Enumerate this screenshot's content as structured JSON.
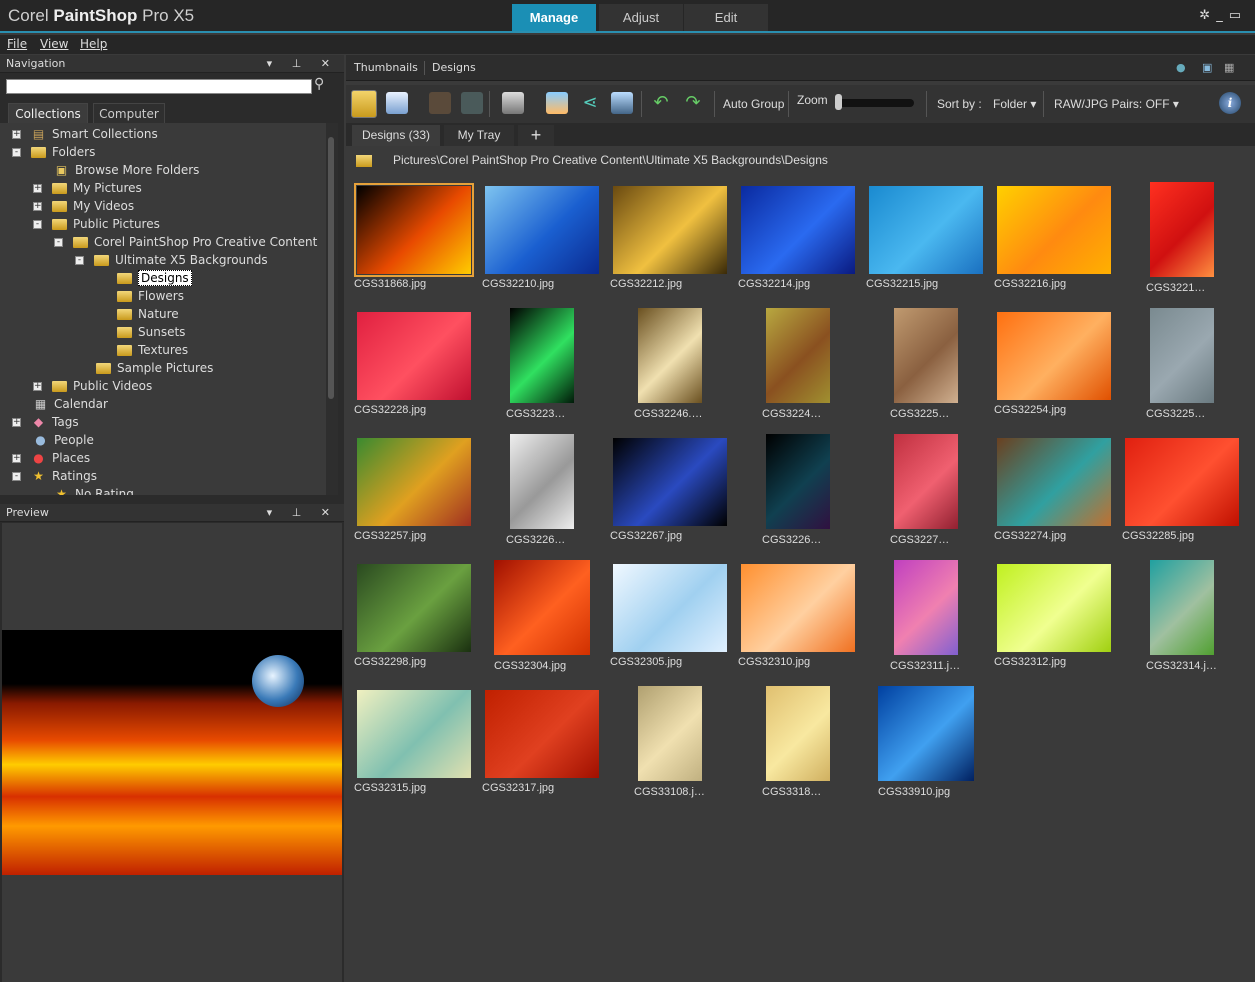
{
  "app": {
    "title_a": "Corel ",
    "title_b": "PaintShop",
    "title_c": " Pro X5",
    "modes": [
      "Manage",
      "Adjust",
      "Edit"
    ],
    "active_mode": "Manage",
    "accent": "#1b8fb5"
  },
  "menu": [
    "File",
    "View",
    "Help"
  ],
  "navigation": {
    "title": "Navigation",
    "search_placeholder": "",
    "tabs": [
      "Collections",
      "Computer"
    ],
    "tree": [
      {
        "label": "Smart Collections",
        "level": 0,
        "exp": "+",
        "icon": "smart-collections"
      },
      {
        "label": "Folders",
        "level": 0,
        "exp": "-",
        "icon": "folder"
      },
      {
        "label": "Browse More Folders",
        "level": 1,
        "exp": "",
        "icon": "folder-add"
      },
      {
        "label": "My Pictures",
        "level": 1,
        "exp": "+",
        "icon": "folder"
      },
      {
        "label": "My Videos",
        "level": 1,
        "exp": "+",
        "icon": "folder"
      },
      {
        "label": "Public Pictures",
        "level": 1,
        "exp": "-",
        "icon": "folder"
      },
      {
        "label": "Corel PaintShop Pro Creative Content",
        "level": 2,
        "exp": "-",
        "icon": "folder"
      },
      {
        "label": "Ultimate X5 Backgrounds",
        "level": 3,
        "exp": "-",
        "icon": "folder"
      },
      {
        "label": "Designs",
        "level": 4,
        "exp": "",
        "icon": "folder",
        "selected": true
      },
      {
        "label": "Flowers",
        "level": 4,
        "exp": "",
        "icon": "folder"
      },
      {
        "label": "Nature",
        "level": 4,
        "exp": "",
        "icon": "folder"
      },
      {
        "label": "Sunsets",
        "level": 4,
        "exp": "",
        "icon": "folder"
      },
      {
        "label": "Textures",
        "level": 4,
        "exp": "",
        "icon": "folder"
      },
      {
        "label": "Sample Pictures",
        "level": 3,
        "exp": "",
        "icon": "folder"
      },
      {
        "label": "Public Videos",
        "level": 1,
        "exp": "+",
        "icon": "folder"
      },
      {
        "label": "Calendar",
        "level": 0,
        "exp": "",
        "icon": "calendar"
      },
      {
        "label": "Tags",
        "level": 0,
        "exp": "+",
        "icon": "tag"
      },
      {
        "label": "People",
        "level": 0,
        "exp": "",
        "icon": "person"
      },
      {
        "label": "Places",
        "level": 0,
        "exp": "+",
        "icon": "pin"
      },
      {
        "label": "Ratings",
        "level": 0,
        "exp": "-",
        "icon": "star"
      },
      {
        "label": "No Rating",
        "level": 1,
        "exp": "",
        "icon": "star"
      }
    ]
  },
  "preview": {
    "title": "Preview"
  },
  "main": {
    "tabs": [
      "Thumbnails",
      "Designs"
    ],
    "toolbar": {
      "auto_group": "Auto Group",
      "zoom": "Zoom",
      "zoom_level": 0.0,
      "sort_by": "Sort by :",
      "sort_value": "Folder",
      "raw_pairs": "RAW/JPG Pairs: OFF"
    },
    "tray_tabs": [
      "Designs (33)",
      "My Tray"
    ],
    "path": "Pictures\\Corel PaintShop Pro Creative Content\\Ultimate X5 Backgrounds\\Designs",
    "thumbnails": [
      {
        "label": "CGS31868.jpg",
        "o": "l",
        "c": [
          "#000",
          "#e84a00",
          "#ffcc00"
        ],
        "selected": true
      },
      {
        "label": "CGS32210.jpg",
        "o": "l",
        "c": [
          "#7ec4f0",
          "#1a5fd0",
          "#0a2a90"
        ]
      },
      {
        "label": "CGS32212.jpg",
        "o": "l",
        "c": [
          "#6a4a10",
          "#f0c040",
          "#3a2a08"
        ]
      },
      {
        "label": "CGS32214.jpg",
        "o": "l",
        "c": [
          "#0a2aa0",
          "#2a6af0",
          "#0a1a80"
        ]
      },
      {
        "label": "CGS32215.jpg",
        "o": "l",
        "c": [
          "#1a8ad0",
          "#4ab8f0",
          "#1a70c0"
        ]
      },
      {
        "label": "CGS32216.jpg",
        "o": "l",
        "c": [
          "#ffd000",
          "#ff8a10",
          "#ffb000"
        ]
      },
      {
        "label": "CGS3221…",
        "o": "p",
        "c": [
          "#ff3020",
          "#d01010",
          "#ff9040"
        ]
      },
      {
        "label": "CGS32228.jpg",
        "o": "l",
        "c": [
          "#e02040",
          "#ff5060",
          "#c01030"
        ]
      },
      {
        "label": "CGS3223…",
        "o": "p",
        "c": [
          "#000",
          "#30e060",
          "#001a08"
        ]
      },
      {
        "label": "CGS32246.…",
        "o": "p",
        "c": [
          "#6a5020",
          "#f0e0b0",
          "#6a5020"
        ]
      },
      {
        "label": "CGS3224…",
        "o": "p",
        "c": [
          "#b8a840",
          "#8a5020",
          "#a09030"
        ]
      },
      {
        "label": "CGS3225…",
        "o": "p",
        "c": [
          "#c09a70",
          "#8a6040",
          "#d0b090"
        ]
      },
      {
        "label": "CGS32254.jpg",
        "o": "l",
        "c": [
          "#ff7010",
          "#ffb060",
          "#e05000"
        ]
      },
      {
        "label": "CGS3225…",
        "o": "p",
        "c": [
          "#7a8a90",
          "#9aa8b0",
          "#6a7a80"
        ]
      },
      {
        "label": "CGS32257.jpg",
        "o": "l",
        "c": [
          "#3a8a30",
          "#e0a020",
          "#a03020"
        ]
      },
      {
        "label": "CGS3226…",
        "o": "p",
        "c": [
          "#eee",
          "#999",
          "#eee"
        ]
      },
      {
        "label": "CGS32267.jpg",
        "o": "l",
        "c": [
          "#000",
          "#2a4ac0",
          "#000"
        ]
      },
      {
        "label": "CGS3226…",
        "o": "p",
        "c": [
          "#000",
          "#104050",
          "#301040"
        ]
      },
      {
        "label": "CGS3227…",
        "o": "p",
        "c": [
          "#c03040",
          "#f06070",
          "#902030"
        ]
      },
      {
        "label": "CGS32274.jpg",
        "o": "l",
        "c": [
          "#6a4020",
          "#30a0a0",
          "#c07030"
        ]
      },
      {
        "label": "CGS32285.jpg",
        "o": "l",
        "c": [
          "#e02010",
          "#ff5030",
          "#c01000"
        ]
      },
      {
        "label": "CGS32298.jpg",
        "o": "l",
        "c": [
          "#2a4a20",
          "#6aa040",
          "#1a3010"
        ]
      },
      {
        "label": "CGS32304.jpg",
        "o": "s",
        "c": [
          "#a01000",
          "#ff6020",
          "#d03000"
        ]
      },
      {
        "label": "CGS32305.jpg",
        "o": "l",
        "c": [
          "#f0f8ff",
          "#a0d0f0",
          "#e0f0ff"
        ]
      },
      {
        "label": "CGS32310.jpg",
        "o": "l",
        "c": [
          "#ff9030",
          "#ffd0a0",
          "#f07020"
        ]
      },
      {
        "label": "CGS32311.j…",
        "o": "p",
        "c": [
          "#c040c0",
          "#f080b0",
          "#8060d0"
        ]
      },
      {
        "label": "CGS32312.jpg",
        "o": "l",
        "c": [
          "#c0f020",
          "#f0ff90",
          "#a0d010"
        ]
      },
      {
        "label": "CGS32314.j…",
        "o": "p",
        "c": [
          "#20a0a0",
          "#a0c0a0",
          "#50a030"
        ]
      },
      {
        "label": "CGS32315.jpg",
        "o": "l",
        "c": [
          "#f0f0c0",
          "#80c0b0",
          "#e0e0b0"
        ]
      },
      {
        "label": "CGS32317.jpg",
        "o": "l",
        "c": [
          "#c02000",
          "#e04020",
          "#a01000"
        ]
      },
      {
        "label": "CGS33108.j…",
        "o": "p",
        "c": [
          "#b0a070",
          "#f0e0b0",
          "#c0b080"
        ]
      },
      {
        "label": "CGS3318…",
        "o": "p",
        "c": [
          "#e0c070",
          "#f8e8a0",
          "#d0b060"
        ]
      },
      {
        "label": "CGS33910.jpg",
        "o": "s",
        "c": [
          "#0040a0",
          "#40a0f0",
          "#002060"
        ]
      }
    ]
  }
}
